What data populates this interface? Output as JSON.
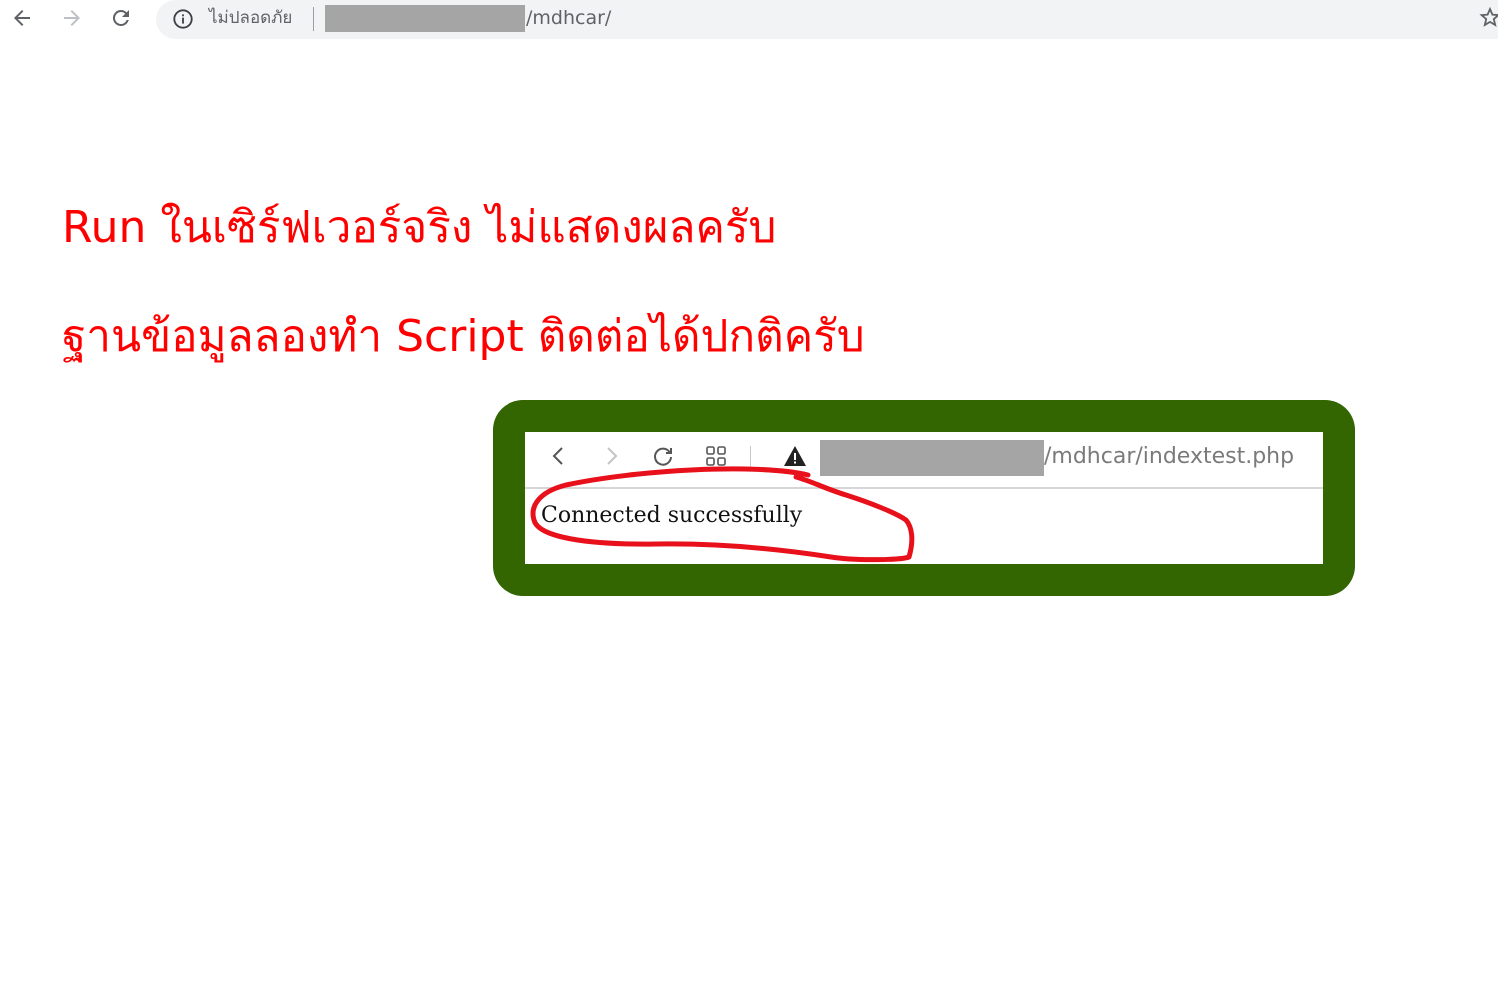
{
  "browser": {
    "security_label": "ไม่ปลอดภัย",
    "url_path": "/mdhcar/"
  },
  "content": {
    "line_1": "Run ในเซิร์ฟเวอร์จริง ไม่แสดงผลครับ",
    "line_2": "ฐานข้อมูลลองทำ Script ติดต่อได้ปกติครับ"
  },
  "embedded_screenshot": {
    "url_path": "/mdhcar/indextest.php",
    "status_text": "Connected successfully"
  },
  "colors": {
    "heading": "#ff0000",
    "frame": "#336600",
    "annotation": "#e8101a",
    "redaction": "#a5a5a5"
  }
}
